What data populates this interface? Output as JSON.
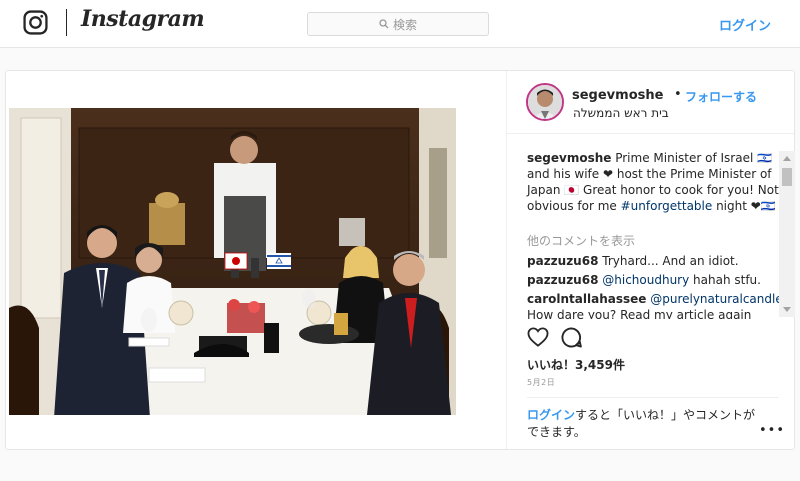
{
  "header": {
    "logo_text": "Instagram",
    "search_placeholder": "検索",
    "login_label": "ログイン"
  },
  "post": {
    "username": "segevmoshe",
    "separator": "•",
    "follow_label": "フォローする",
    "location": "בית ראש הממשלה",
    "caption": {
      "username": "segevmoshe",
      "text_1": " Prime Minister of Israel 🇮🇱 and his wife ❤ host the Prime Minister of Japan 🇯🇵 Great honor to cook for you! Not obvious for me ",
      "hashtag": "#unforgettable",
      "text_2": " night ❤🇮🇱"
    },
    "view_more_comments": "他のコメントを表示",
    "comments": [
      {
        "username": "pazzuzu68",
        "text": " Tryhard... And an idiot.",
        "mention": ""
      },
      {
        "username": "pazzuzu68",
        "mention": "@hichoudhury",
        "text": " hahah stfu."
      },
      {
        "username": "carolntallahassee",
        "mention": "@purelynaturalcandles",
        "text": ""
      },
      {
        "username": "",
        "mention": "",
        "text": "How dare you? Read my article again"
      }
    ],
    "likes_text": "いいね！3,459件",
    "date": "5月2日",
    "login_prompt": {
      "link": "ログイン",
      "text": "すると「いいね！」やコメントができます。"
    },
    "more_options": "•••"
  },
  "colors": {
    "link_blue": "#3897f0",
    "hashtag_blue": "#003569",
    "muted": "#999999",
    "text": "#262626"
  },
  "icons": [
    "instagram-glyph-icon",
    "search-icon",
    "heart-icon",
    "comment-icon",
    "more-options-icon"
  ]
}
